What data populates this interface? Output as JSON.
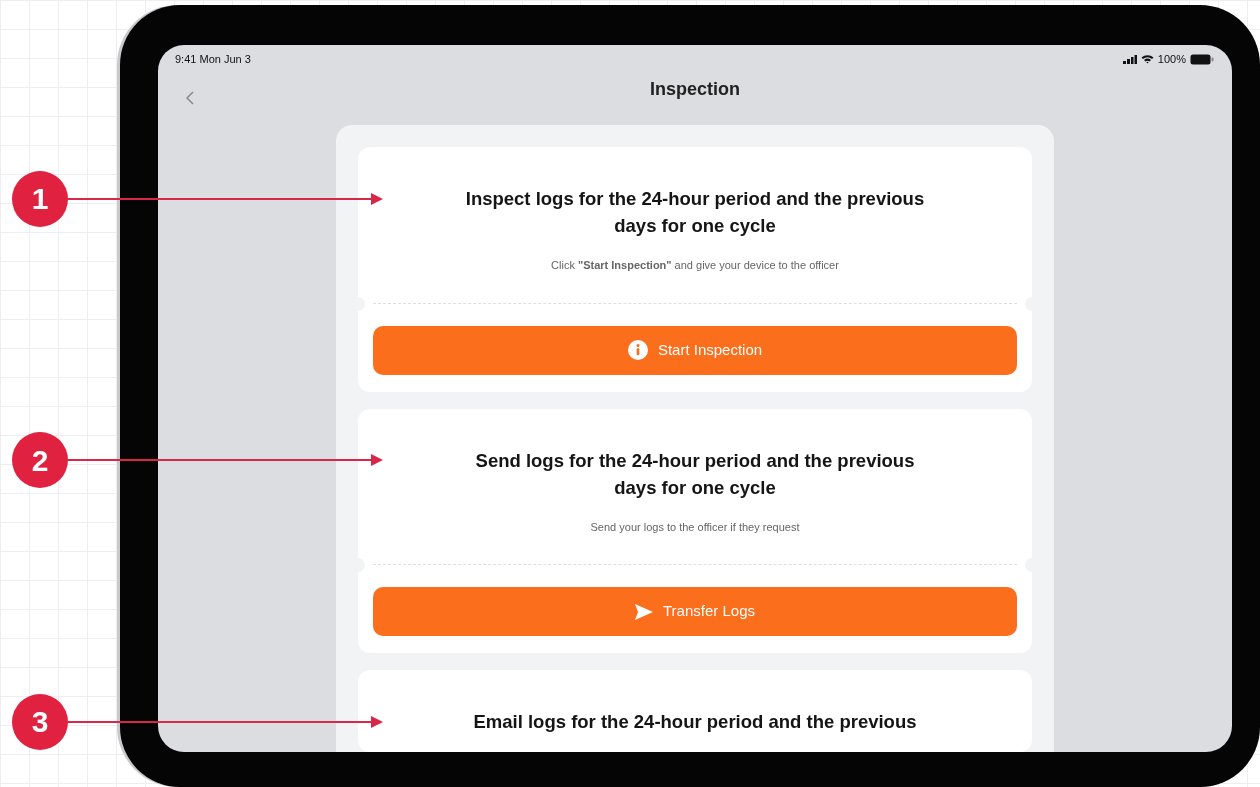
{
  "status_bar": {
    "time": "9:41 Mon Jun 3",
    "battery": "100%"
  },
  "nav": {
    "title": "Inspection"
  },
  "cards": [
    {
      "title": "Inspect logs for the 24-hour period and the previous days for one cycle",
      "subtitle": "Click **\"Start Inspection\"** and give your device to the officer",
      "button": {
        "label": "Start Inspection",
        "kind": "info"
      }
    },
    {
      "title": "Send logs for the 24-hour period and the previous days for one cycle",
      "subtitle": "Send your logs to the officer if they request",
      "button": {
        "label": "Transfer Logs",
        "kind": "send"
      }
    },
    {
      "title": "Email logs for the 24-hour period and the previous"
    }
  ],
  "callouts": [
    {
      "number": "1"
    },
    {
      "number": "2"
    },
    {
      "number": "3"
    }
  ]
}
